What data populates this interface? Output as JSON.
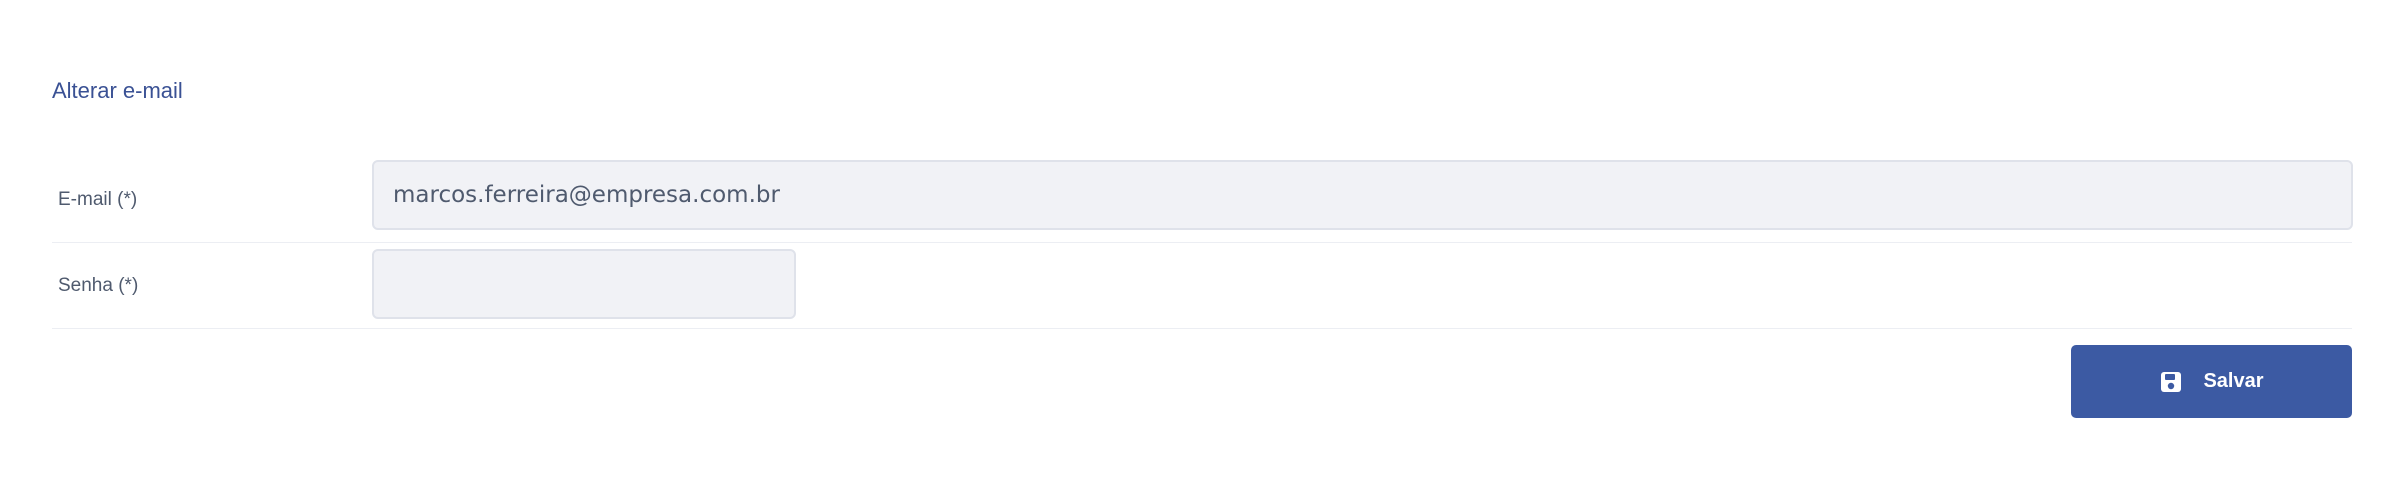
{
  "section": {
    "title": "Alterar e-mail"
  },
  "form": {
    "email": {
      "label": "E-mail (*)",
      "value": "marcos.ferreira@empresa.com.br"
    },
    "password": {
      "label": "Senha (*)",
      "value": ""
    }
  },
  "actions": {
    "save_label": "Salvar",
    "save_icon": "floppy-disk-icon"
  },
  "colors": {
    "primary": "#3c5aa3",
    "title": "#3a5194",
    "input_bg": "#f1f2f6"
  }
}
